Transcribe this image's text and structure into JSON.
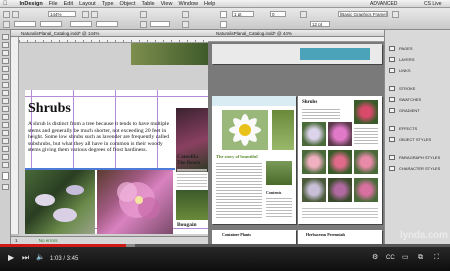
{
  "menubar": {
    "app": "InDesign",
    "items": [
      "File",
      "Edit",
      "Layout",
      "Type",
      "Object",
      "Table",
      "View",
      "Window",
      "Help"
    ],
    "workspace": "ADVANCED",
    "cs_live": "CS Live"
  },
  "control": {
    "font_size": "12 pt",
    "zoom": "144%",
    "stroke": "1 pt",
    "font_field": "[Basic Graphics Frame]",
    "small_value": "0"
  },
  "doc_left": {
    "tab": "NaturalisPlanal_Catalog.indd* @ 144%",
    "heading": "Shrubs",
    "body": "A shrub is distinct from a tree because it tends to have multiple stems and generally be much shorter, not exceeding 20 feet in height. Some low shrubs such as lavender are frequently called subshrubs, but what they all have in common is their woody stems giving them various degrees of frost hardiness.",
    "side_text_1": "Camellia",
    "side_text_2": "The Bourn",
    "side_text_3": "Bougain",
    "status": "1",
    "status_errors": "No errors"
  },
  "doc_right": {
    "tab": "NaturalisPlanal_Catalog.indd* @ 44%",
    "page_title_1": "Shrubs",
    "page_title_2": "The story of beautiful",
    "contents": "Contents",
    "bottom_1": "Container Plants",
    "bottom_2": "Herbaceous Perennials"
  },
  "panels": {
    "items": [
      "PAGES",
      "LAYERS",
      "LINKS",
      "STROKE",
      "SWATCHES",
      "GRADIENT",
      "EFFECTS",
      "OBJECT STYLES",
      "PARAGRAPH STYLES",
      "CHARACTER STYLES"
    ]
  },
  "player": {
    "time": "1:03 / 3:45",
    "progress_fraction": 0.28,
    "buffered_fraction": 0.3,
    "watermark": "lynda.com"
  },
  "colors": {
    "guide": "#b38bd6",
    "progress": "#d01a1a",
    "accent_green": "#5a8a2a"
  }
}
